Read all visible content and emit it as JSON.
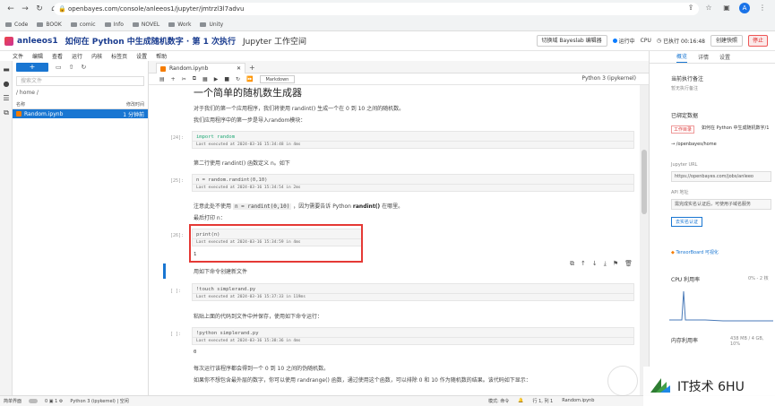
{
  "browser": {
    "url": "openbayes.com/console/anleeos1/jupyter/jmtrzl3l7advu",
    "bookmarks": [
      "Code",
      "BOOK",
      "comic",
      "Info",
      "NOVEL",
      "Work",
      "Unity"
    ],
    "profile_letter": "A"
  },
  "app": {
    "workspace": "anleeos1",
    "title": "如何在 Python 中生成随机数字 · 第 1 次执行",
    "subtitle": "Jupyter 工作空间",
    "switch_button": "切换域 Bayeslab 编辑器",
    "status": "运行中",
    "cpu": "CPU",
    "elapsed": "已执行 00:16:48",
    "create_button": "创建快照",
    "stop_button": "停止"
  },
  "menu": [
    "文件",
    "编辑",
    "查看",
    "运行",
    "内核",
    "标签页",
    "设置",
    "帮助"
  ],
  "filebrowser": {
    "new_label": "+",
    "search_placeholder": "搜索文件",
    "path": "/ home /",
    "col_name": "名称",
    "col_modified": "修改时间",
    "file_name": "Random.ipynb",
    "file_time": "1 分钟前"
  },
  "notebook": {
    "tab_name": "Random.ipynb",
    "cell_type": "Markdown",
    "kernel": "Python 3 (ipykernel)",
    "heading": "一个简单的随机数生成器",
    "p1": "对于我们的第一个应用程序，我们将使用 randint() 生成一个在 0 到 10 之间的随机数。",
    "p2": "我们应用程序中的第一步是导入random模块：",
    "c1_prompt": "[24]:",
    "c1_code": "import random",
    "c1_exec": "Last executed at 2024-03-16 15:34:48 in 4ms",
    "p3": "第二行使用 randint() 函数定义 n。如下",
    "c2_prompt": "[25]:",
    "c2_code": "n = random.randint(0,10)",
    "c2_exec": "Last executed at 2024-03-16 15:34:54 in 2ms",
    "p4a": "注意此处不使用",
    "p4code": "n = randint(0,10)",
    "p4b": "，因为需要告诉 Python",
    "p4bold": "randint()",
    "p4c": "在哪里。",
    "p5": "最后打印 n：",
    "c3_prompt": "[26]:",
    "c3_code": "print(n)",
    "c3_exec": "Last executed at 2024-03-16 15:34:59 in 4ms",
    "c3_output": "1",
    "p6": "用如下命令创建新文件",
    "c4_prompt": "[ ]:",
    "c4_code": "!touch simplerand.py",
    "c4_exec": "Last executed at 2024-03-16 15:37:33 in 119ms",
    "p7": "粘贴上面的代码到文件中并保存，使用如下命令运行：",
    "c5_prompt": "[ ]:",
    "c5_code": "!python simplerand.py",
    "c5_exec": "Last executed at 2024-03-16 15:38:36 in 4ms",
    "c5_output": "0",
    "p8": "每次运行该程序都会得到一个 0 到 10 之间的伪随机数。",
    "p9": "如果你不想包含最外层的数字，你可以使用 randrange() 函数，通过使用这个函数，可以排除 0 和 10 作为随机数的结果。该代码如下显示："
  },
  "rightpanel": {
    "tabs": [
      "概览",
      "详情",
      "设置"
    ],
    "exec_note_label": "当前执行备注",
    "exec_note": "暂无执行备注",
    "bound_data_label": "已绑定数据",
    "tag": "工作目录",
    "mount": "如何在 Python 中生成随机数字/1",
    "mount_path": "→ /openbayes/home",
    "jupyter_url_label": "Jupyter URL",
    "jupyter_url": "https://openbayes.com/jobs/anleeo",
    "api_label": "API 地址",
    "api_value": "需完成实名认证后，可使用子域名服务",
    "verify_button": "去实名认证",
    "tensorboard": "TensorBoard 可视化",
    "cpu_label": "CPU 利用率",
    "cpu_range": "0% - 2 核",
    "mem_label": "内存利用率",
    "mem_value": "438 MB / 4 GB, 10%"
  },
  "statusbar": {
    "mode": "简单界面",
    "kernel": "Python 3 (ipykernel) | 空闲",
    "edit_mode": "模式: 命令",
    "cursor": "行 1, 列 1",
    "file": "Random.ipynb"
  },
  "watermark": "IT技术 6HU"
}
